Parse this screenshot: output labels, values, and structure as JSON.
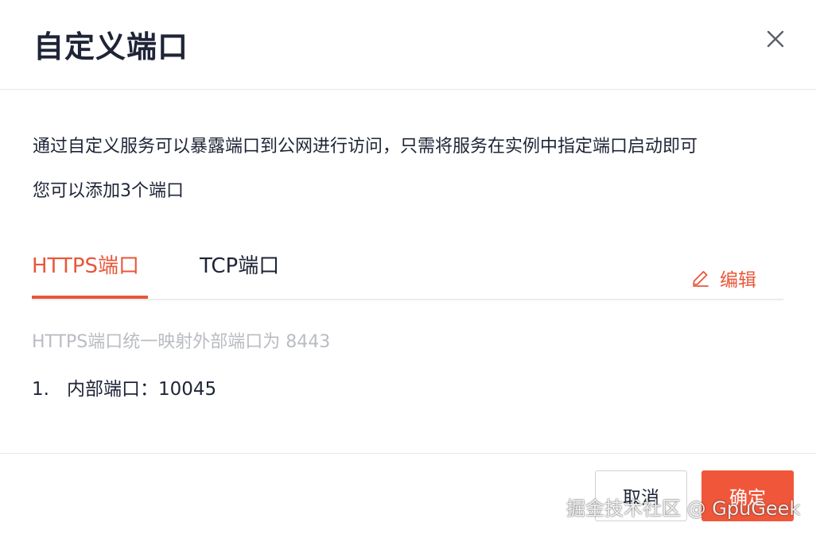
{
  "dialog": {
    "title": "自定义端口",
    "close_icon": "close-icon"
  },
  "description": {
    "line1": "通过自定义服务可以暴露端口到公网进行访问，只需将服务在实例中指定端口启动即可",
    "line2": "您可以添加3个端口"
  },
  "tabs": [
    {
      "label": "HTTPS端口",
      "active": true
    },
    {
      "label": "TCP端口",
      "active": false
    }
  ],
  "edit": {
    "label": "编辑",
    "icon": "pencil-icon"
  },
  "https_panel": {
    "note": "HTTPS端口统一映射外部端口为 8443",
    "ports": [
      {
        "index": "1.",
        "label": "内部端口：10045"
      }
    ]
  },
  "footer": {
    "cancel_label": "取消",
    "ok_label": "确定"
  },
  "watermark": "掘金技术社区 @ GpuGeek",
  "colors": {
    "accent": "#e8573a",
    "primary_button": "#f0573a",
    "text": "#1f2437",
    "muted_text": "#b9bcc2",
    "divider": "#e8e8ea"
  }
}
